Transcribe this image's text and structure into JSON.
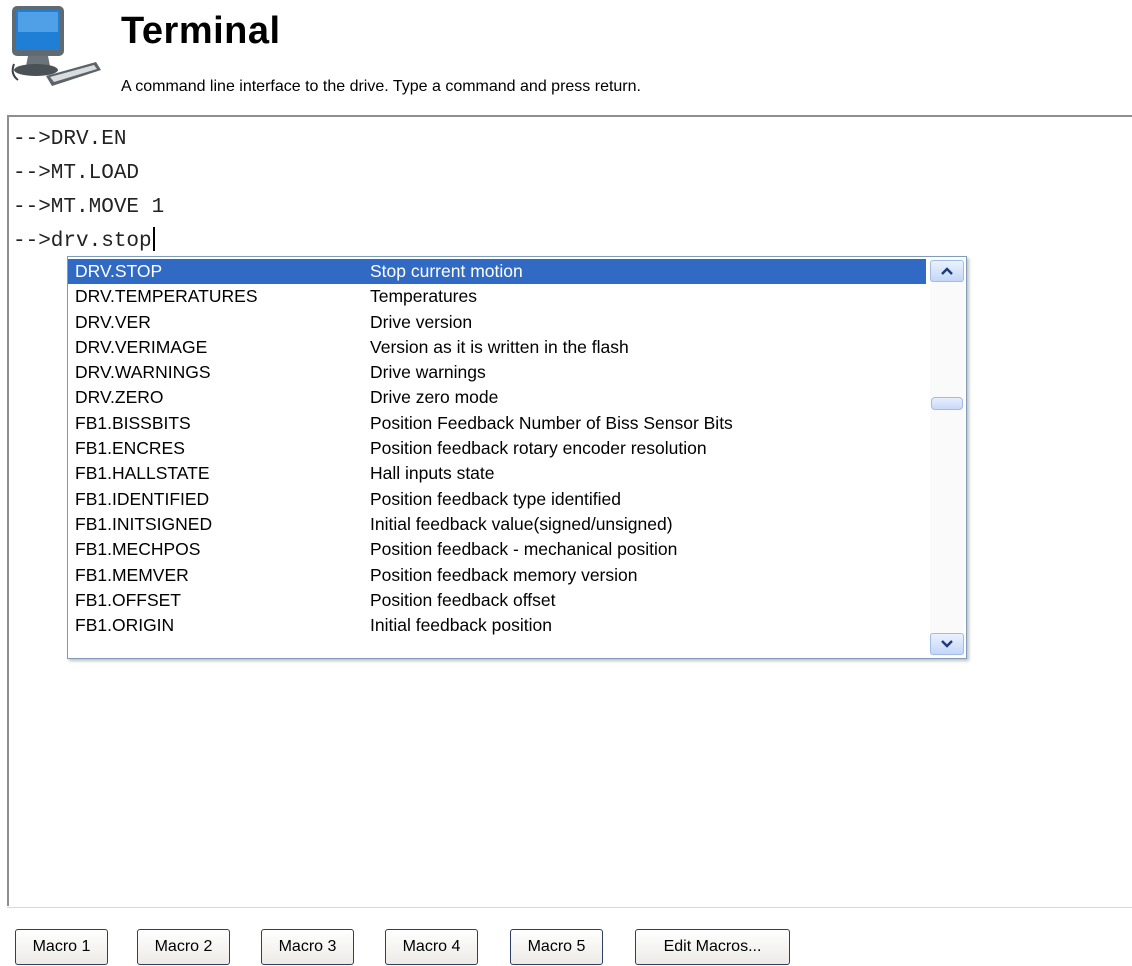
{
  "header": {
    "icon": "computer-terminal-icon",
    "title": "Terminal",
    "subtitle": "A command line interface to the drive. Type a command and press return."
  },
  "terminal": {
    "lines": [
      "-->DRV.EN",
      "-->MT.LOAD",
      "-->MT.MOVE 1",
      "-->drv.stop"
    ]
  },
  "autocomplete": {
    "selected_index": 0,
    "items": [
      {
        "cmd": "DRV.STOP",
        "desc": "Stop current motion"
      },
      {
        "cmd": "DRV.TEMPERATURES",
        "desc": "Temperatures"
      },
      {
        "cmd": "DRV.VER",
        "desc": "Drive version"
      },
      {
        "cmd": "DRV.VERIMAGE",
        "desc": "Version as it is written in the flash"
      },
      {
        "cmd": "DRV.WARNINGS",
        "desc": "Drive warnings"
      },
      {
        "cmd": "DRV.ZERO",
        "desc": "Drive zero mode"
      },
      {
        "cmd": "FB1.BISSBITS",
        "desc": "Position Feedback Number of Biss Sensor Bits"
      },
      {
        "cmd": "FB1.ENCRES",
        "desc": "Position feedback rotary encoder resolution"
      },
      {
        "cmd": "FB1.HALLSTATE",
        "desc": "Hall inputs state"
      },
      {
        "cmd": "FB1.IDENTIFIED",
        "desc": "Position feedback type identified"
      },
      {
        "cmd": "FB1.INITSIGNED",
        "desc": "Initial feedback value(signed/unsigned)"
      },
      {
        "cmd": "FB1.MECHPOS",
        "desc": "Position feedback - mechanical position"
      },
      {
        "cmd": "FB1.MEMVER",
        "desc": "Position feedback memory version"
      },
      {
        "cmd": "FB1.OFFSET",
        "desc": "Position feedback offset"
      },
      {
        "cmd": "FB1.ORIGIN",
        "desc": "Initial feedback position"
      }
    ],
    "scroll_up_icon": "chevron-up-icon",
    "scroll_down_icon": "chevron-down-icon",
    "selected_color": "#316ac5"
  },
  "macros": {
    "buttons": [
      "Macro 1",
      "Macro 2",
      "Macro 3",
      "Macro 4",
      "Macro 5",
      "Edit Macros..."
    ]
  }
}
